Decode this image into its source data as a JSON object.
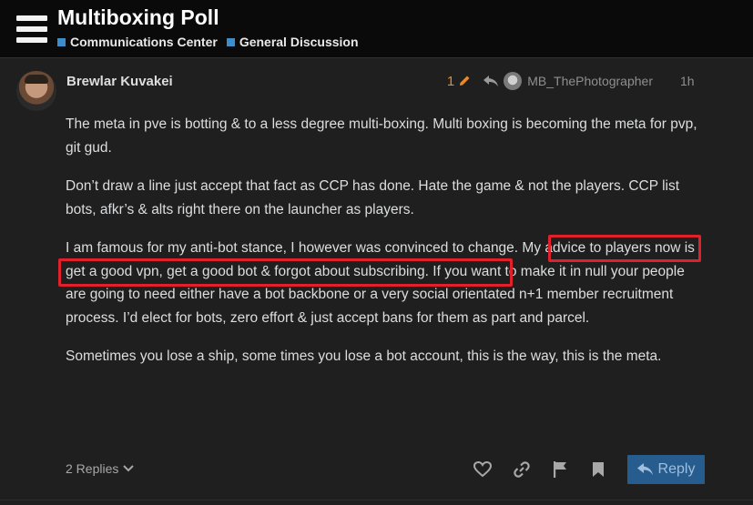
{
  "header": {
    "title": "Multiboxing Poll",
    "breadcrumbs": [
      {
        "label": "Communications Center",
        "color": "#3c8dcb"
      },
      {
        "label": "General Discussion",
        "color": "#3c8dcb"
      }
    ]
  },
  "post": {
    "author": "Brewlar Kuvakei",
    "edit_count": "1",
    "reply_to": "MB_ThePhotographer",
    "time": "1h",
    "paragraphs": [
      "The meta in pve is botting & to a less degree multi-boxing. Multi boxing is becoming the meta for pvp, git gud.",
      "Don’t draw a line just accept that fact as CCP has done. Hate the game & not the players. CCP list bots, afkr’s & alts right there on the launcher as players.",
      "I am famous for my anti-bot stance, I however was convinced to change. My advice to players now is get a good vpn, get a good bot & forgot about subscribing. If you want to make it in null your people are going to need either have a bot backbone or a very social orientated n+1 member recruitment process. I’d elect for bots, zero effort & just accept bans for them as part and parcel.",
      "Sometimes you lose a ship, some times you lose a bot account, this is the way, this is the meta."
    ]
  },
  "actions": {
    "replies_label": "2 Replies",
    "reply_label": "Reply",
    "icons": [
      "heart-icon",
      "link-icon",
      "flag-icon",
      "bookmark-icon"
    ]
  },
  "colors": {
    "accent": "#3c8dcb",
    "highlight": "#e0202a",
    "edit": "#e88a2b"
  }
}
